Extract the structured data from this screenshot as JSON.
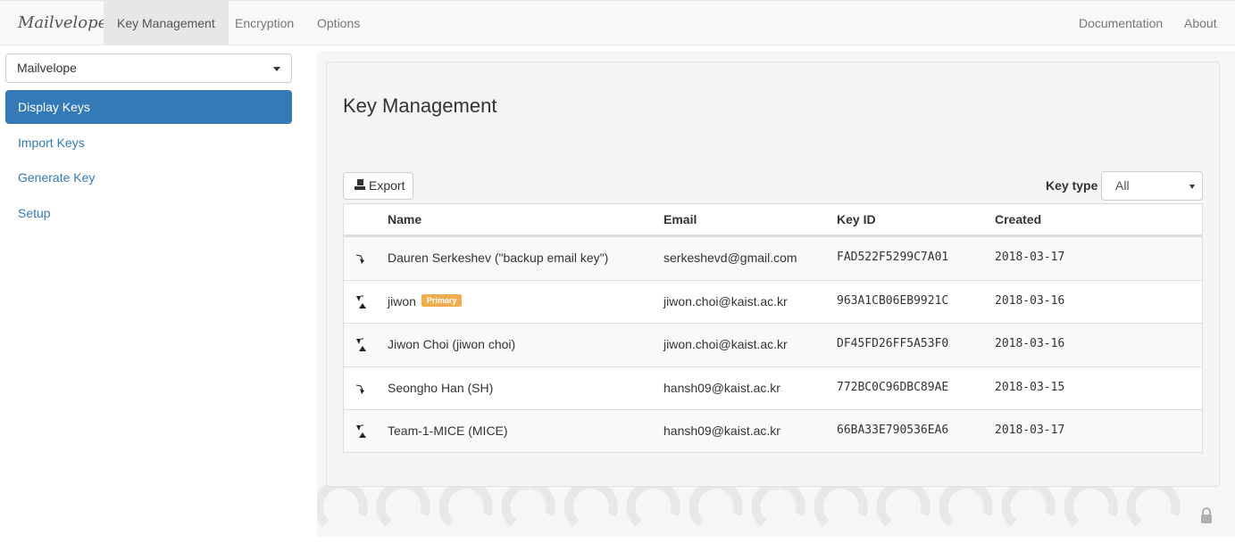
{
  "nav": {
    "brand": "Mailvelope",
    "items": [
      "Key Management",
      "Encryption",
      "Options"
    ],
    "right_items": [
      "Documentation",
      "About"
    ]
  },
  "sidebar": {
    "keyring": "Mailvelope",
    "items": [
      "Display Keys",
      "Import Keys",
      "Generate Key",
      "Setup"
    ]
  },
  "main": {
    "title": "Key Management",
    "export_label": "Export",
    "keytype_label": "Key type",
    "keytype_value": "All",
    "columns": [
      "Name",
      "Email",
      "Key ID",
      "Created"
    ],
    "rows": [
      {
        "type": "public",
        "name": "Dauren Serkeshev (\"backup email key\")",
        "badge": "",
        "email": "serkeshevd@gmail.com",
        "keyid": "FAD522F5299C7A01",
        "created": "2018-03-17"
      },
      {
        "type": "keypair",
        "name": "jiwon",
        "badge": "Primary",
        "email": "jiwon.choi@kaist.ac.kr",
        "keyid": "963A1CB06EB9921C",
        "created": "2018-03-16"
      },
      {
        "type": "keypair",
        "name": "Jiwon Choi (jiwon choi)",
        "badge": "",
        "email": "jiwon.choi@kaist.ac.kr",
        "keyid": "DF45FD26FF5A53F0",
        "created": "2018-03-16"
      },
      {
        "type": "public",
        "name": "Seongho Han (SH)",
        "badge": "",
        "email": "hansh09@kaist.ac.kr",
        "keyid": "772BC0C96DBC89AE",
        "created": "2018-03-15"
      },
      {
        "type": "keypair",
        "name": "Team-1-MICE (MICE)",
        "badge": "",
        "email": "hansh09@kaist.ac.kr",
        "keyid": "66BA33E790536EA6",
        "created": "2018-03-17"
      }
    ]
  },
  "colors": {
    "accent": "#337ab7",
    "badge": "#f0ad4e"
  }
}
